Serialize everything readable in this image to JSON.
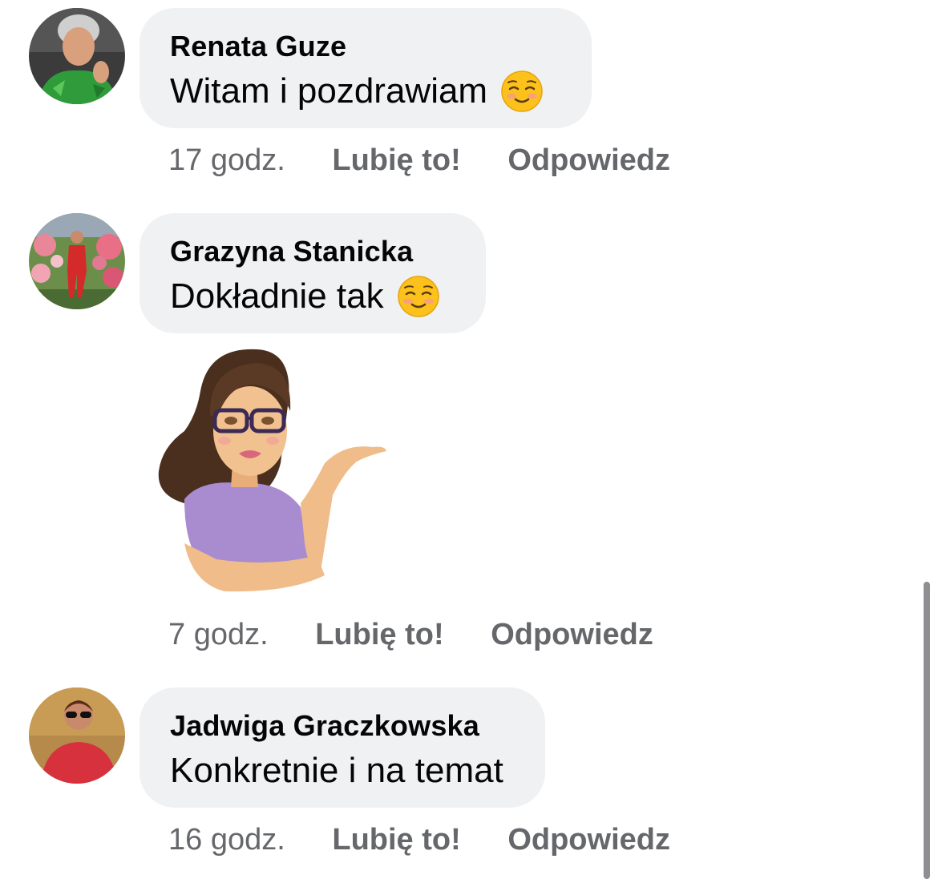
{
  "comments": [
    {
      "author": "Renata Guze",
      "text": "Witam i pozdrawiam",
      "emoji": "smiling-face-emoji",
      "time": "17 godz.",
      "like_label": "Lubię to!",
      "reply_label": "Odpowiedz"
    },
    {
      "author": "Grazyna Stanicka",
      "text": "Dokładnie tak",
      "emoji": "smiling-face-emoji",
      "sticker": "avatar-sticker-shrug",
      "time": "7 godz.",
      "like_label": "Lubię to!",
      "reply_label": "Odpowiedz"
    },
    {
      "author": "Jadwiga Graczkowska",
      "text": "Konkretnie i na temat",
      "time": "16 godz.",
      "like_label": "Lubię to!",
      "reply_label": "Odpowiedz"
    }
  ],
  "colors": {
    "bubble": "#f0f1f3",
    "meta_text": "#65676b",
    "text": "#050505"
  }
}
